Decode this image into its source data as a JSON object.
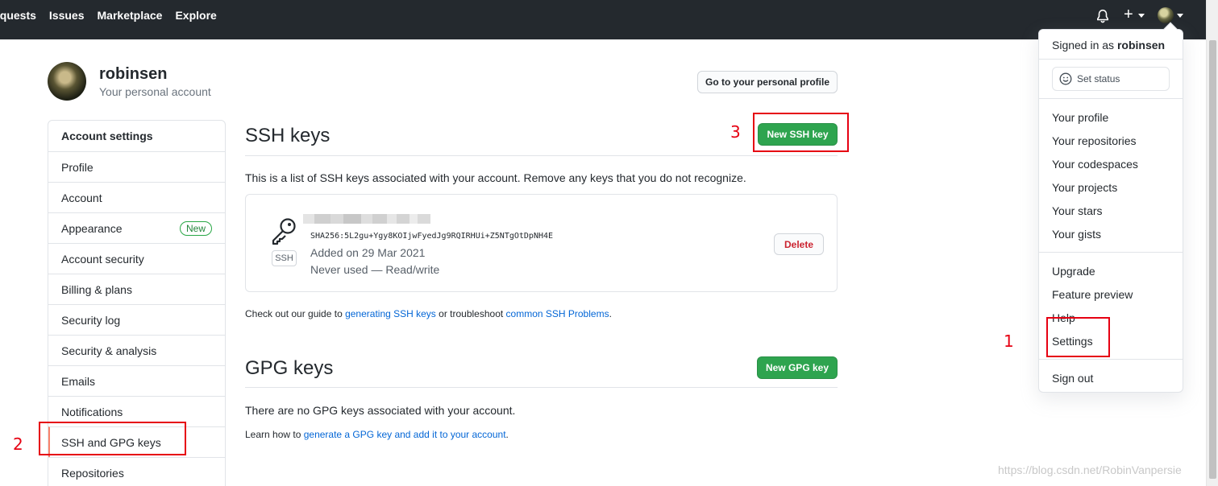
{
  "topnav": {
    "items": [
      "equests",
      "Issues",
      "Marketplace",
      "Explore"
    ]
  },
  "header_icons": [
    "bell-icon",
    "plus-icon",
    "avatar"
  ],
  "profile": {
    "username": "robinsen",
    "subtitle": "Your personal account",
    "profile_button": "Go to your personal profile"
  },
  "sidebar": {
    "items": [
      {
        "label": "Account settings"
      },
      {
        "label": "Profile"
      },
      {
        "label": "Account"
      },
      {
        "label": "Appearance",
        "badge": "New"
      },
      {
        "label": "Account security"
      },
      {
        "label": "Billing & plans"
      },
      {
        "label": "Security log"
      },
      {
        "label": "Security & analysis"
      },
      {
        "label": "Emails"
      },
      {
        "label": "Notifications"
      },
      {
        "label": "SSH and GPG keys",
        "selected": true
      },
      {
        "label": "Repositories"
      }
    ]
  },
  "ssh": {
    "title": "SSH keys",
    "new_button": "New SSH key",
    "intro": "This is a list of SSH keys associated with your account. Remove any keys that you do not recognize.",
    "key": {
      "type_label": "SSH",
      "fingerprint": "SHA256:5L2gu+Ygy8KOIjwFyedJg9RQIRHUi+Z5NTgOtDpNH4E",
      "added": "Added on 29 Mar 2021",
      "usage": "Never used — Read/write",
      "delete_button": "Delete"
    },
    "guide": {
      "prefix": "Check out our guide to ",
      "link1": "generating SSH keys",
      "middle": " or troubleshoot ",
      "link2": "common SSH Problems",
      "suffix": "."
    }
  },
  "gpg": {
    "title": "GPG keys",
    "new_button": "New GPG key",
    "empty": "There are no GPG keys associated with your account.",
    "learn": {
      "prefix": "Learn how to ",
      "link": "generate a GPG key and add it to your account",
      "suffix": "."
    }
  },
  "dropdown": {
    "signed_in_prefix": "Signed in as ",
    "signed_in_user": "robinsen",
    "set_status": "Set status",
    "group1": [
      "Your profile",
      "Your repositories",
      "Your codespaces",
      "Your projects",
      "Your stars",
      "Your gists"
    ],
    "group2": [
      "Upgrade",
      "Feature preview",
      "Help",
      "Settings"
    ],
    "sign_out": "Sign out"
  },
  "annotations": {
    "step1": "1",
    "step2": "2",
    "step3": "3",
    "color": "#e60012"
  },
  "watermark": "https://blog.csdn.net/RobinVanpersie",
  "colors": {
    "header_bg": "#24292e",
    "green": "#2ea44f",
    "link": "#0366d6",
    "danger": "#cb2431"
  }
}
